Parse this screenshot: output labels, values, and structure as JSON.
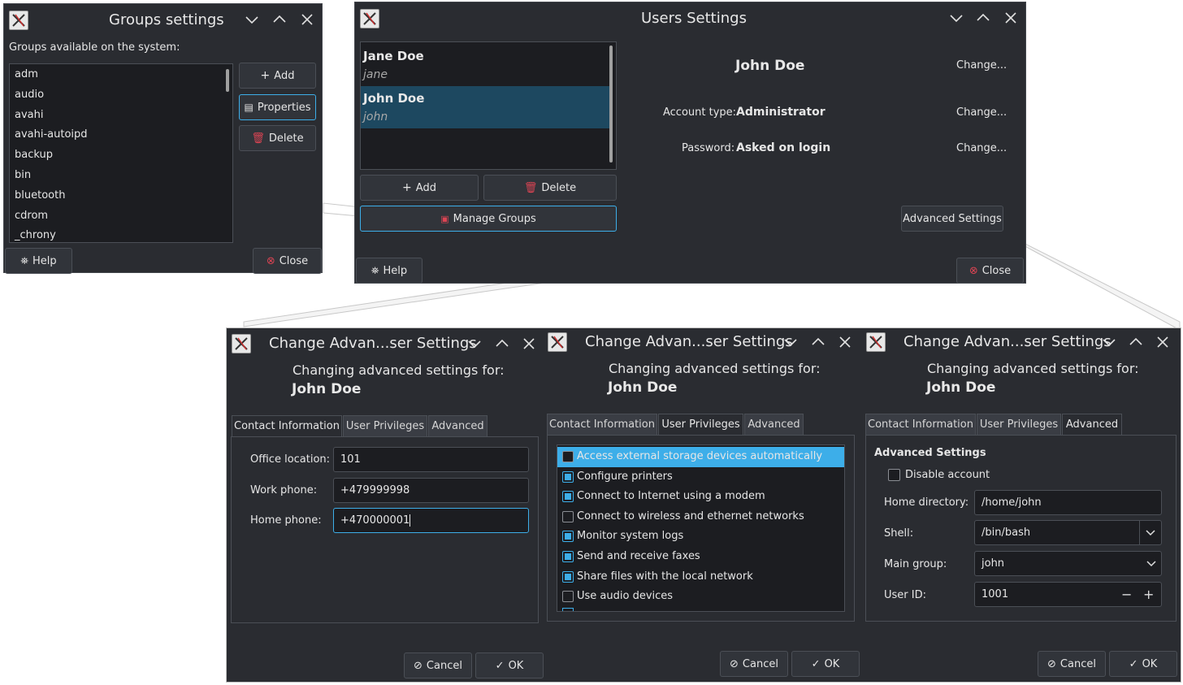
{
  "common": {
    "help_label": "Help",
    "close_label": "Close",
    "add_label": "Add",
    "delete_label": "Delete",
    "change_label": "Change...",
    "cancel_label": "Cancel",
    "ok_label": "OK",
    "dialog_title": "Change Advan...ser Settings",
    "changing_for": "Changing advanced settings for:",
    "user_fullname": "John Doe",
    "tabs": [
      "Contact Information",
      "User Privileges",
      "Advanced"
    ]
  },
  "groups_window": {
    "title": "Groups settings",
    "heading": "Groups available on the system:",
    "groups": [
      "adm",
      "audio",
      "avahi",
      "avahi-autoipd",
      "backup",
      "bin",
      "bluetooth",
      "cdrom",
      "_chrony"
    ],
    "properties_label": "Properties"
  },
  "users_window": {
    "title": "Users Settings",
    "users": [
      {
        "name": "Jane Doe",
        "login": "jane"
      },
      {
        "name": "John Doe",
        "login": "john"
      }
    ],
    "manage_groups_label": "Manage Groups",
    "selected_name": "John Doe",
    "account_type_label": "Account type:",
    "account_type_value": "Administrator",
    "password_label": "Password:",
    "password_value": "Asked on login",
    "advanced_settings_label": "Advanced Settings"
  },
  "contact_dialog": {
    "office_label": "Office location:",
    "office_value": "101",
    "work_label": "Work phone:",
    "work_value": "+479999998",
    "home_label": "Home phone:",
    "home_value": "+470000001"
  },
  "privileges_dialog": {
    "items": [
      {
        "label": "Access external storage devices automatically",
        "checked": false,
        "selected": true
      },
      {
        "label": "Configure printers",
        "checked": true,
        "selected": false
      },
      {
        "label": "Connect to Internet using a modem",
        "checked": true,
        "selected": false
      },
      {
        "label": "Connect to wireless and ethernet networks",
        "checked": false,
        "selected": false
      },
      {
        "label": "Monitor system logs",
        "checked": true,
        "selected": false
      },
      {
        "label": "Send and receive faxes",
        "checked": true,
        "selected": false
      },
      {
        "label": "Share files with the local network",
        "checked": true,
        "selected": false
      },
      {
        "label": "Use audio devices",
        "checked": false,
        "selected": false
      }
    ]
  },
  "advanced_dialog": {
    "section_title": "Advanced Settings",
    "disable_account_label": "Disable account",
    "home_dir_label": "Home directory:",
    "home_dir_value": "/home/john",
    "shell_label": "Shell:",
    "shell_value": "/bin/bash",
    "main_group_label": "Main group:",
    "main_group_value": "john",
    "user_id_label": "User ID:",
    "user_id_value": "1001"
  }
}
